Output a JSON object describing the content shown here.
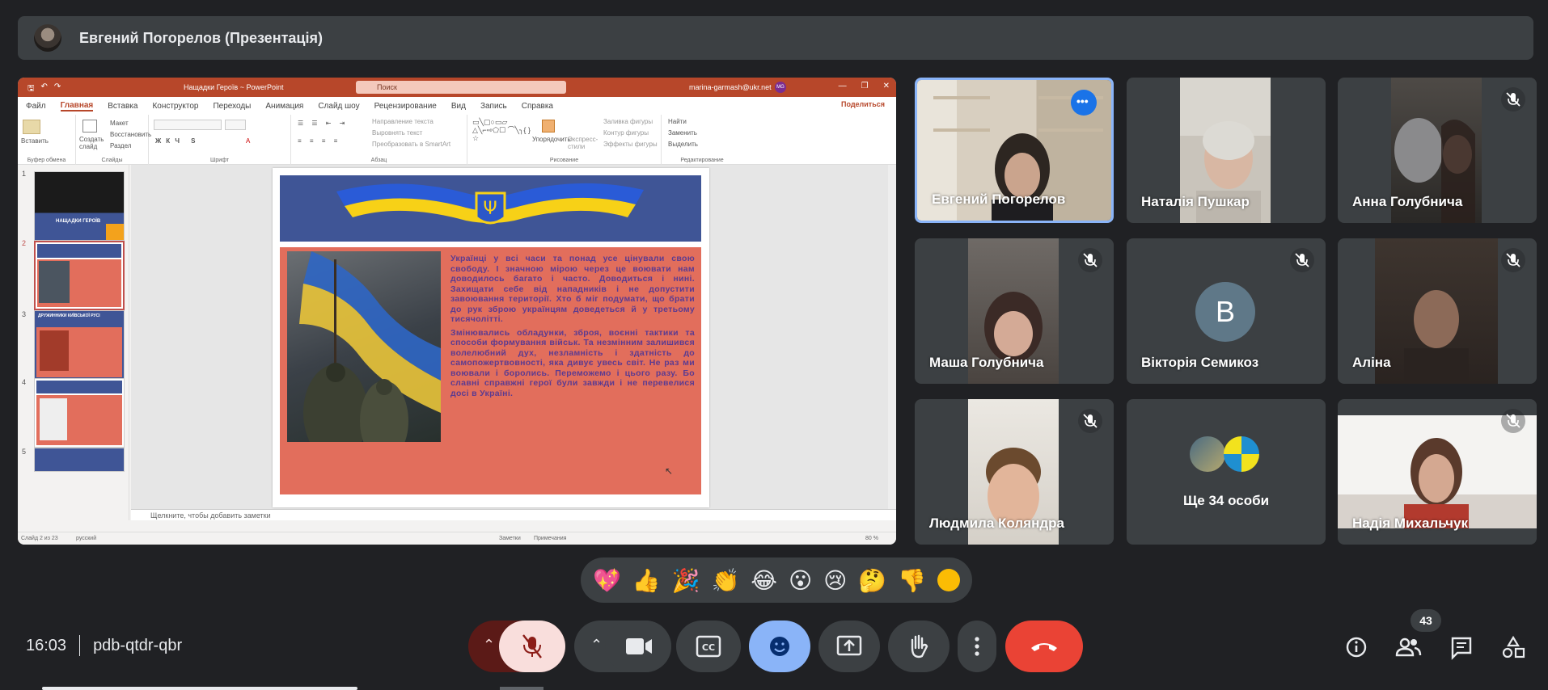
{
  "presenter_bar": {
    "label": "Евгений Погорелов (Презентація)"
  },
  "powerpoint": {
    "doc_title": "Нащадки Героїв  ~  PowerPoint",
    "search_placeholder": "Поиск",
    "user_email": "marina-garmash@ukr.net",
    "user_initials": "MG",
    "share_label": "Поделиться",
    "tabs": [
      "Файл",
      "Главная",
      "Вставка",
      "Конструктор",
      "Переходы",
      "Анимация",
      "Слайд шоу",
      "Рецензирование",
      "Вид",
      "Запись",
      "Справка"
    ],
    "active_tab": "Главная",
    "ribbon": {
      "paste": "Вставить",
      "clipboard_group": "Буфер обмена",
      "new_slide": "Создать слайд",
      "layout": "Макет",
      "reset": "Восстановить",
      "section": "Раздел",
      "slides_group": "Слайды",
      "font_group": "Шрифт",
      "paragraph_group": "Абзац",
      "text_direction": "Направление текста",
      "align_text": "Выровнять текст",
      "convert_smartart": "Преобразовать в SmartArt",
      "arrange": "Упорядочить",
      "quick_styles": "Экспресс-стили",
      "shape_fill": "Заливка фигуры",
      "shape_outline": "Контур фигуры",
      "shape_effects": "Эффекты фигуры",
      "drawing_group": "Рисование",
      "find": "Найти",
      "replace": "Заменить",
      "select": "Выделить",
      "editing_group": "Редактирование"
    },
    "slide_numbers": [
      "1",
      "2",
      "3",
      "4",
      "5"
    ],
    "thumb1_caption": "НАЩАДКИ ГЕРОЇВ",
    "thumb3_caption": "ДРУЖИННИКИ КИЇВСЬКОЇ РУСІ",
    "slide_text_p1": "Українці у всі часи та понад усе цінували свою свободу. І значною мірою через це воювати нам доводилось багато і часто. Доводиться і нині. Захищати себе від нападників і не допустити завоювання території. Хто б міг подумати, що брати до рук зброю українцям доведеться й у третьому тисячолітті.",
    "slide_text_p2": "Змінювались обладунки, зброя, воєнні тактики та способи формування військ. Та незмінним залишився волелюбний дух, незламність і здатність до самопожертвовності, яка дивує увесь світ. Не раз ми воювали і боролись. Переможемо і цього разу. Бо славні справжні герої були завжди і не перевелися досі в Україні.",
    "notes_placeholder": "Щелкните, чтобы добавить заметки",
    "status_slide": "Слайд 2 из 23",
    "status_lang": "русский",
    "status_notes": "Заметки",
    "status_comments": "Примечания",
    "status_zoom": "80 %"
  },
  "participants": [
    {
      "name": "Евгений Погорелов"
    },
    {
      "name": "Наталія Пушкар"
    },
    {
      "name": "Анна Голубнича"
    },
    {
      "name": "Маша Голубнича"
    },
    {
      "name": "Вікторія Семикоз",
      "initial": "В"
    },
    {
      "name": "Аліна"
    },
    {
      "name": "Людмила Коляндра"
    },
    {
      "name": "Ще 34 особи"
    },
    {
      "name": "Надія Михальчук"
    }
  ],
  "reactions": [
    "💖",
    "👍",
    "🎉",
    "👏",
    "😂",
    "😮",
    "😢",
    "🤔",
    "👎"
  ],
  "meeting": {
    "time": "16:03",
    "code": "pdb-qtdr-qbr"
  },
  "people_count": "43",
  "colors": {
    "background": "#202124",
    "tile": "#3c4043",
    "end_call": "#ea4335",
    "active_control": "#8ab4f8",
    "mic_off": "#f9dedc",
    "ppt_accent": "#b7472a"
  }
}
